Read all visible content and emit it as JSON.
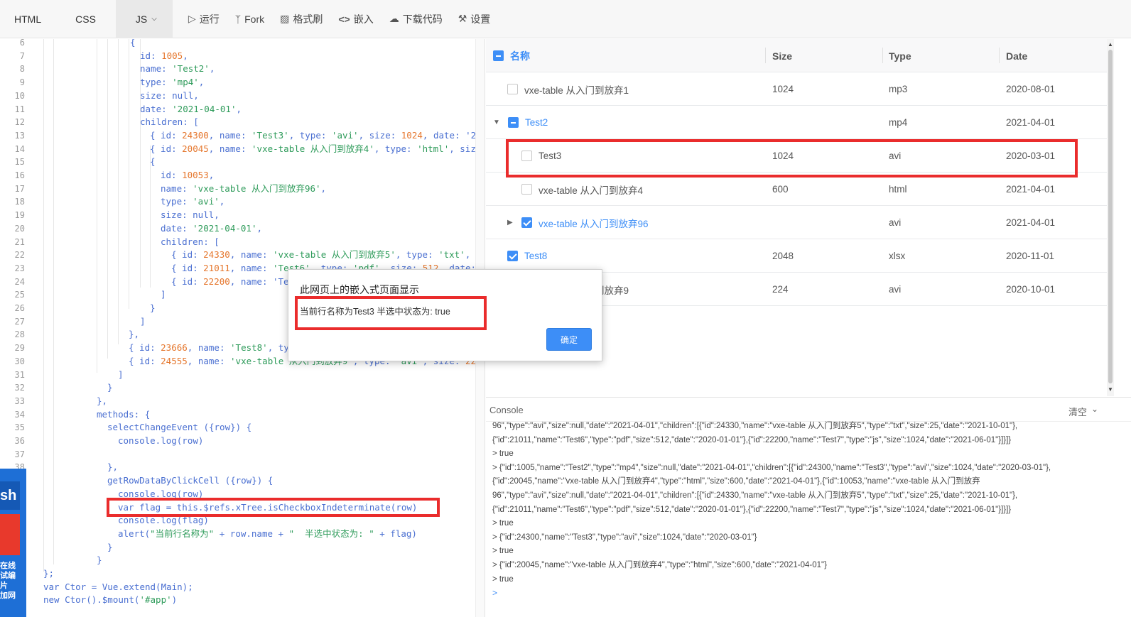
{
  "toolbar": {
    "tabs": [
      "HTML",
      "CSS",
      "JS"
    ],
    "actions": [
      "运行",
      "Fork",
      "格式刷",
      "嵌入",
      "下载代码",
      "设置"
    ]
  },
  "editor": {
    "line_numbers": [
      "6",
      "7",
      "8",
      "9",
      "10",
      "11",
      "12",
      "13",
      "14",
      "15",
      "16",
      "17",
      "18",
      "19",
      "20",
      "21",
      "22",
      "23",
      "24",
      "25",
      "26",
      "27",
      "28",
      "29",
      "30",
      "31",
      "32",
      "33",
      "34",
      "35",
      "36",
      "37",
      "38",
      "",
      "",
      "",
      "",
      "",
      "",
      "",
      ""
    ],
    "lines": [
      "{",
      "  id: 1005,",
      "  name: 'Test2',",
      "  type: 'mp4',",
      "  size: null,",
      "  date: '2021-04-01',",
      "  children: [",
      "    { id: 24300, name: 'Test3', type: 'avi', size: 1024, date: '20",
      "    { id: 20045, name: 'vxe-table 从入门到放弃4', type: 'html', siz",
      "    {",
      "      id: 10053,",
      "      name: 'vxe-table 从入门到放弃96',",
      "      type: 'avi',",
      "      size: null,",
      "      date: '2021-04-01',",
      "      children: [",
      "        { id: 24330, name: 'vxe-table 从入门到放弃5', type: 'txt',",
      "        { id: 21011, name: 'Test6', type: 'pdf', size: 512, date:",
      "        { id: 22200, name: 'Te",
      "      ]",
      "    }",
      "  ]",
      "},",
      "{ id: 23666, name: 'Test8', ty",
      "{ id: 24555, name: 'vxe-table 从入门到放弃9', type: 'avi', size: 22",
      "]",
      "}",
      "},",
      "methods: {",
      "  selectChangeEvent ({row}) {",
      "    console.log(row)",
      "",
      "  },",
      "  getRowDataByClickCell ({row}) {",
      "    console.log(row)",
      "    var flag = this.$refs.xTree.isCheckboxIndeterminate(row)",
      "    console.log(flag)",
      "    alert(\"当前行名称为\" + row.name + \"  半选中状态为: \" + flag)",
      "  }",
      "}",
      "};",
      "var Ctor = Vue.extend(Main);",
      "new Ctor().$mount('#app')"
    ]
  },
  "table": {
    "headers": [
      "名称",
      "Size",
      "Type",
      "Date"
    ],
    "rows": [
      {
        "name": "vxe-table 从入门到放弃1",
        "size": "1024",
        "type": "mp3",
        "date": "2020-08-01"
      },
      {
        "name": "Test2",
        "size": "",
        "type": "mp4",
        "date": "2021-04-01"
      },
      {
        "name": "Test3",
        "size": "1024",
        "type": "avi",
        "date": "2020-03-01"
      },
      {
        "name": "vxe-table 从入门到放弃4",
        "size": "600",
        "type": "html",
        "date": "2021-04-01"
      },
      {
        "name": "vxe-table 从入门到放弃96",
        "size": "",
        "type": "avi",
        "date": "2021-04-01"
      },
      {
        "name": "Test8",
        "size": "2048",
        "type": "xlsx",
        "date": "2020-11-01"
      },
      {
        "name": "vxe-table 从入门到放弃9",
        "size": "224",
        "type": "avi",
        "date": "2020-10-01"
      }
    ]
  },
  "console": {
    "title": "Console",
    "clear": "清空",
    "lines": [
      "96\",\"type\":\"avi\",\"size\":null,\"date\":\"2021-04-01\",\"children\":[{\"id\":24330,\"name\":\"vxe-table 从入门到放弃5\",\"type\":\"txt\",\"size\":25,\"date\":\"2021-10-01\"},",
      "{\"id\":21011,\"name\":\"Test6\",\"type\":\"pdf\",\"size\":512,\"date\":\"2020-01-01\"},{\"id\":22200,\"name\":\"Test7\",\"type\":\"js\",\"size\":1024,\"date\":\"2021-06-01\"}]}]}",
      "> true",
      "> {\"id\":1005,\"name\":\"Test2\",\"type\":\"mp4\",\"size\":null,\"date\":\"2021-04-01\",\"children\":[{\"id\":24300,\"name\":\"Test3\",\"type\":\"avi\",\"size\":1024,\"date\":\"2020-03-01\"},",
      "{\"id\":20045,\"name\":\"vxe-table 从入门到放弃4\",\"type\":\"html\",\"size\":600,\"date\":\"2021-04-01\"},{\"id\":10053,\"name\":\"vxe-table 从入门到放弃",
      "96\",\"type\":\"avi\",\"size\":null,\"date\":\"2021-04-01\",\"children\":[{\"id\":24330,\"name\":\"vxe-table 从入门到放弃5\",\"type\":\"txt\",\"size\":25,\"date\":\"2021-10-01\"},",
      "{\"id\":21011,\"name\":\"Test6\",\"type\":\"pdf\",\"size\":512,\"date\":\"2020-01-01\"},{\"id\":22200,\"name\":\"Test7\",\"type\":\"js\",\"size\":1024,\"date\":\"2021-06-01\"}]}]}",
      "> true",
      "> {\"id\":24300,\"name\":\"Test3\",\"type\":\"avi\",\"size\":1024,\"date\":\"2020-03-01\"}",
      "> true",
      "> {\"id\":20045,\"name\":\"vxe-table 从入门到放弃4\",\"type\":\"html\",\"size\":600,\"date\":\"2021-04-01\"}",
      "> true"
    ],
    "prompt": ">"
  },
  "dialog": {
    "title": "此网页上的嵌入式页面显示",
    "message": "当前行名称为Test3  半选中状态为: true",
    "ok": "确定"
  },
  "side_ad": {
    "logo": "sh",
    "text": "在线\n试编\n片\n加网"
  },
  "colors": {
    "accent": "#3d8ef7",
    "highlight": "#ea2c2c",
    "code_keyword": "#4a6fd1",
    "code_string": "#2e9b5a",
    "code_number": "#e5762c"
  }
}
